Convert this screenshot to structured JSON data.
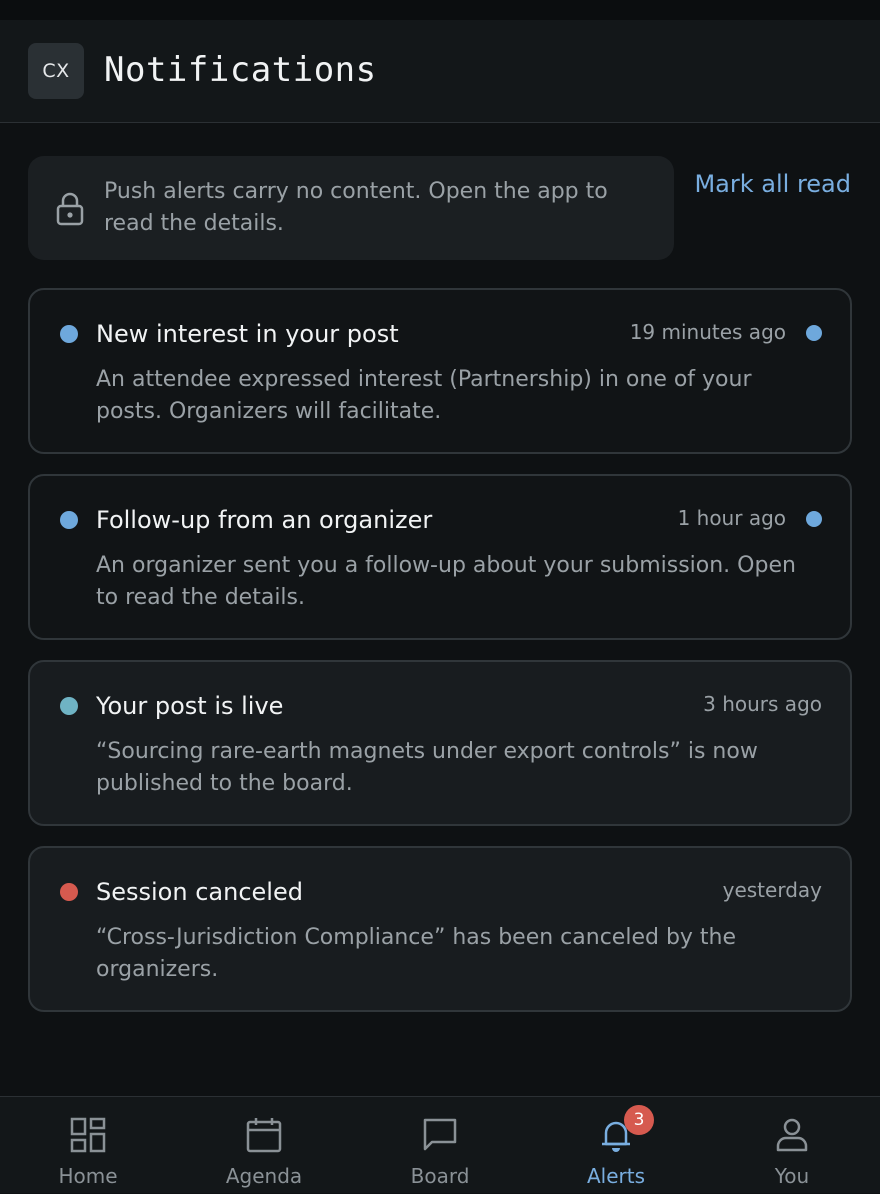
{
  "header": {
    "avatar_initials": "CX",
    "title": "Notifications"
  },
  "notice": {
    "text": "Push alerts carry no content. Open the app to read the details.",
    "icon": "lock-icon"
  },
  "actions": {
    "mark_all_read": "Mark all read"
  },
  "notifications": [
    {
      "title": "New interest in your post",
      "time": "19 minutes ago",
      "body": "An attendee expressed interest (Partnership) in one of your posts. Organizers will facilitate.",
      "dot_color": "#6ea8dc",
      "unread": true
    },
    {
      "title": "Follow-up from an organizer",
      "time": "1 hour ago",
      "body": "An organizer sent you a follow-up about your submission. Open to read the details.",
      "dot_color": "#6ea8dc",
      "unread": true
    },
    {
      "title": "Your post is live",
      "time": "3 hours ago",
      "body": "“Sourcing rare-earth magnets under export controls” is now published to the board.",
      "dot_color": "#6fb3c4",
      "unread": false
    },
    {
      "title": "Session canceled",
      "time": "yesterday",
      "body": "“Cross-Jurisdiction Compliance” has been canceled by the organizers.",
      "dot_color": "#d65a4f",
      "unread": false
    }
  ],
  "nav": {
    "items": [
      {
        "label": "Home",
        "icon": "dashboard-icon"
      },
      {
        "label": "Agenda",
        "icon": "calendar-icon"
      },
      {
        "label": "Board",
        "icon": "chat-bubble-icon"
      },
      {
        "label": "Alerts",
        "icon": "bell-icon",
        "active": true,
        "badge": "3"
      },
      {
        "label": "You",
        "icon": "person-icon"
      }
    ]
  },
  "colors": {
    "accent": "#79aee0",
    "badge": "#d65a4f",
    "background": "#0e1113"
  }
}
